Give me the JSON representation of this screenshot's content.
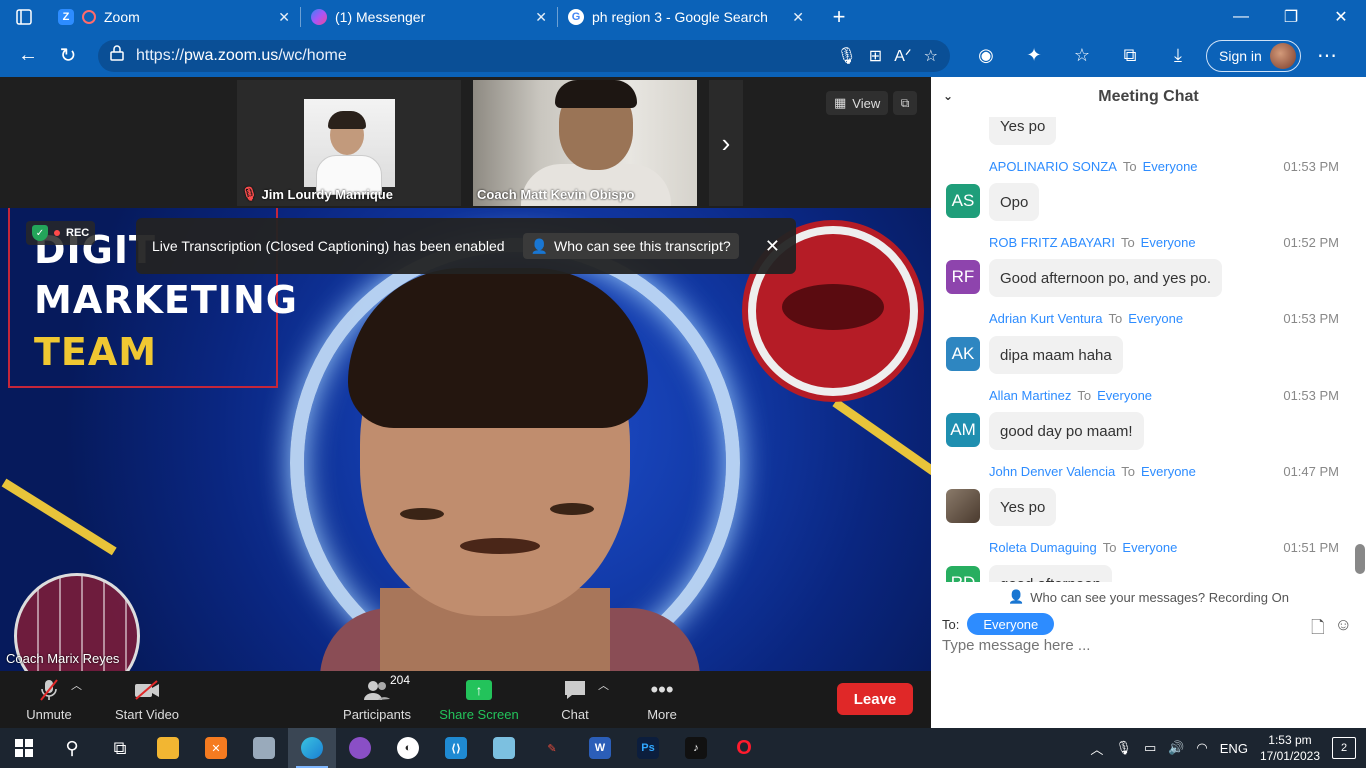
{
  "browser": {
    "tabs": [
      {
        "title": "Zoom",
        "active": true
      },
      {
        "title": "(1) Messenger",
        "active": false
      },
      {
        "title": "ph region 3 - Google Search",
        "active": false
      }
    ],
    "url_prefix": "https://",
    "url_domain": "pwa.zoom.us",
    "url_path": "/wc/home",
    "signin_label": "Sign in"
  },
  "gallery": {
    "participants": [
      {
        "name": "Jim Lourdy Manrique",
        "muted": true
      },
      {
        "name": "Coach Matt Kevin Obispo",
        "muted": false
      }
    ],
    "view_label": "View"
  },
  "speaker": {
    "name": "Coach Marix Reyes",
    "background_lines": [
      "DIGIT",
      "MARKETING",
      "TEAM"
    ]
  },
  "recording": {
    "label": "REC"
  },
  "transcription_banner": {
    "message": "Live Transcription (Closed Captioning) has been enabled",
    "who_label": "Who can see this transcript?"
  },
  "controls": {
    "unmute": "Unmute",
    "start_video": "Start Video",
    "participants": "Participants",
    "participant_count": "204",
    "share_screen": "Share Screen",
    "chat": "Chat",
    "more": "More",
    "leave": "Leave"
  },
  "chat": {
    "title": "Meeting Chat",
    "top_partial_message": "Yes po",
    "messages": [
      {
        "sender": "APOLINARIO SONZA",
        "to": "To",
        "recipient": "Everyone",
        "time": "01:53 PM",
        "initials": "AS",
        "color": "#1f9e7a",
        "text": "Opo"
      },
      {
        "sender": "ROB FRITZ ABAYARI",
        "to": "To",
        "recipient": "Everyone",
        "time": "01:52 PM",
        "initials": "RF",
        "color": "#8e44ad",
        "text": "Good afternoon po, and yes po."
      },
      {
        "sender": "Adrian Kurt Ventura",
        "to": "To",
        "recipient": "Everyone",
        "time": "01:53 PM",
        "initials": "AK",
        "color": "#2e86c1",
        "text": "dipa maam haha"
      },
      {
        "sender": "Allan Martinez",
        "to": "To",
        "recipient": "Everyone",
        "time": "01:53 PM",
        "initials": "AM",
        "color": "#1f8fb0",
        "text": "good day po maam!"
      },
      {
        "sender": "John Denver Valencia",
        "to": "To",
        "recipient": "Everyone",
        "time": "01:47 PM",
        "initials": "",
        "color": "#7a6a5a",
        "text": "Yes po"
      },
      {
        "sender": "Roleta Dumaguing",
        "to": "To",
        "recipient": "Everyone",
        "time": "01:51 PM",
        "initials": "RD",
        "color": "#27ae60",
        "text": "good afternoon"
      }
    ],
    "who_can_see": "Who can see your messages? Recording On",
    "to_label": "To:",
    "recipient_pill": "Everyone",
    "input_placeholder": "Type message here ..."
  },
  "taskbar": {
    "language": "ENG",
    "time": "1:53 pm",
    "date": "17/01/2023",
    "notification_count": "2"
  }
}
